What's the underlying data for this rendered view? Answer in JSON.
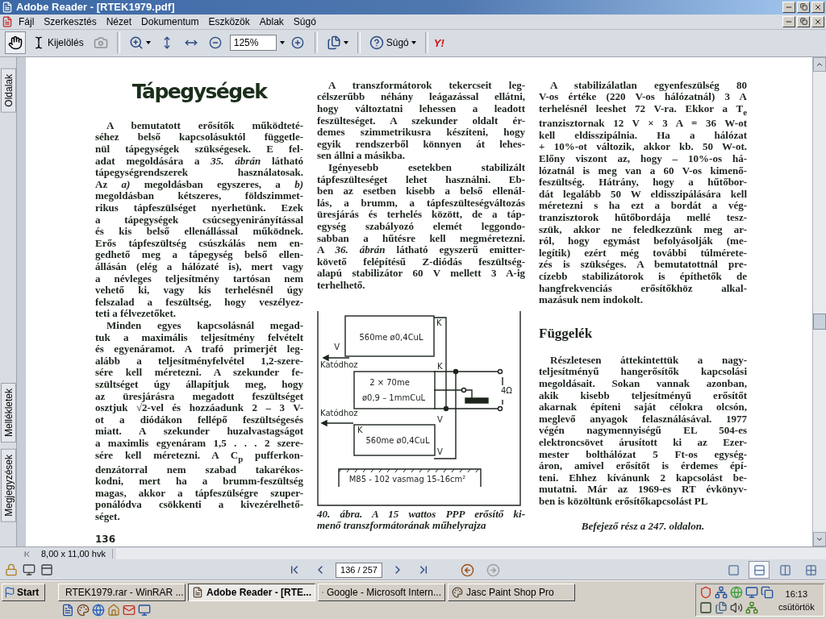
{
  "window": {
    "title": "Adobe Reader - [RTEK1979.pdf]"
  },
  "menu": [
    "Fájl",
    "Szerkesztés",
    "Nézet",
    "Dokumentum",
    "Eszközök",
    "Ablak",
    "Súgó"
  ],
  "toolbar": {
    "hand_selected": true,
    "select_label": "Kijelölés",
    "zoom": "125%",
    "help_label": "Súgó",
    "badge": "Y!"
  },
  "side_tabs": [
    "Oldalak",
    "Mellékletek",
    "Megjegyzések"
  ],
  "page": {
    "title": "Tápegységek",
    "left": [
      {
        "lines": [
          "A bemutatott erősítők működteté-",
          "séhez belső kapcsolásuktól függetle-",
          "nül tápegységek szükségesek. E fel-",
          "adat megoldására a *35. ábrán* látható",
          "tápegységrendszerek használatosak.",
          "Az *a)* megoldásban egyszeres, a *b)*",
          "megoldásban kétszeres, földszimmet-",
          "rikus tápfeszülséget nyerhetünk. Ezek",
          "a tápegységek csúcsegyenirányítással",
          "és kis belső ellenállással működnek.",
          "Erős tápfeszültség csúszkálás nem en-",
          "gedhető meg a tápegység belső ellen-",
          "állásán (elég a hálózaté is), mert vagy",
          "a névleges teljesítmény tartósan nem",
          "vehető ki, vagy kis terhelésnél úgy",
          "felszalad a feszültség, hogy veszélyez-",
          "teti a félvezetőket."
        ]
      },
      {
        "lines": [
          "Minden egyes kapcsolásnál megad-",
          "tuk a maximális teljesítmény felvételt",
          "és egyenáramot. A trafó primerjét leg-",
          "alább a teljesítményfelvétel 1,2-szere-",
          "sére kell méretezni. A szekunder fe-",
          "szültséget úgy állapítjuk meg, hogy",
          "az üresjárásra megadott feszültséget",
          "osztjuk √2-vel és hozzáadunk 2 – 3 V-",
          "ot a diódákon fellépő feszültségesés",
          "miatt. A szekunder huzalvastagságot",
          "a maximlis egyenáram 1,5 . . . 2 szere-",
          "sére kell méretezni. A C$_{p}$ pufferkon-",
          "denzátorral nem szabad takarékos-",
          "kodni, mert ha a brumm-feszültség",
          "magas, akkor a tápfeszülségre szuper-",
          "ponálódva csökkenti a kivezérelhető-",
          "séget."
        ]
      }
    ],
    "page_number": "136",
    "middle": [
      {
        "lines": [
          "A transzformátorok tekercseit leg-",
          "célszerűbb néhány leágazással ellátni,",
          "hogy változtatni lehessen a leadott",
          "feszülteséget. A szekunder oldalt ér-",
          "demes szimmetrikusra készíteni, hogy",
          "egyik rendszerből könnyen át lehes-",
          "sen állni a másikba."
        ]
      },
      {
        "lines": [
          "Igényesebb esetekben stabilizált",
          "tápfeszülteséget lehet használni. Eb-",
          "ben az esetben kisebb a belső ellenál-",
          "lás, a brumm, a tápfeszülteségváltozás",
          "üresjárás és terhelés között, de a táp-",
          "egység szabályozó elemét leggondo-",
          "sabban a hűtésre kell megméretezni.",
          "A *36. ábrán* látható egyszerű emitter-",
          "követő felépítésű Z-diódás feszültség-",
          "alapú stabilizátor 60 V mellett 3 A-ig",
          "terhelhető."
        ]
      }
    ],
    "figure": {
      "labels": [
        "560me ø0,4CuL",
        "K",
        "V",
        "Katódhoz",
        "K",
        "2 × 70me",
        "ø0,9 – 1mmCuL",
        "V",
        "4Ω",
        "Katódhoz",
        "K",
        "560me ø0,4CuL",
        "V",
        "M85 - 102 vasmag 15-16cm²"
      ]
    },
    "caption": {
      "lines": [
        "40. ábra. A 15 wattos PPP erősítő ki-",
        "menő transzformátorának műhelyrajza"
      ]
    },
    "right": [
      {
        "lines": [
          "A stabilizálatlan egyenfeszülség 80",
          "V-os értéke (220 V-os hálózatnál) 3 A",
          "terhelésnél leeshet 72 V-ra. Ekkor a T$_{e}$",
          "tranzisztornak 12 V × 3 A = 36 W-ot",
          "kell eldisszipálnia. Ha a hálózat",
          "+ 10%-ot változik, akkor kb. 50 W-ot.",
          "Előny viszont az, hogy – 10%-os há-",
          "lózatnál is meg van a 60 V-os kimenő-",
          "feszültség. Hátrány, hogy a hűtőbor-",
          "dát legalább 50 W eldisszipálására kell",
          "méretezni s ha ezt a bordát a vég-",
          "tranzisztorok hűtőbordája mellé tesz-",
          "szük, akkor ne feledkezzünk meg ar-",
          "ról, hogy egymást befolyásolják (me-",
          "legítik) ezért még további túlmérete-",
          "zés is szükséges. A bemutatottnál pre-",
          "cízebb stabilizátorok is építhetők de",
          "hangfrekvenciás erősítőkhöz alkal-",
          "mazásuk nem indokolt."
        ]
      }
    ],
    "section_heading": "Függelék",
    "section": [
      {
        "lines": [
          "Részletesen áttekintettük a nagy-",
          "teljesítményű hangerősítők kapcsolási",
          "megoldásait. Sokan vannak azonban,",
          "akik kisebb teljesítményű erősítőt",
          "akarnak építeni saját célokra olcsón,",
          "meglevő anyagok felasználásával. 1977",
          "végén nagymennyiségű EL 504-es",
          "elektroncsövet árusított ki az Ezer-",
          "mester bolthálózat 5 Ft-os egység-",
          "áron, amivel erősítőt is érdemes épí-",
          "teni. Ehhez kívánunk 2 kapcsolást be-",
          "mutatni. Már az 1969-es RT évkönyv-",
          "ben is közöltünk erősítőkapcsolást PL"
        ]
      }
    ],
    "continued": "Befejező rész a 247. oldalon."
  },
  "status": {
    "page_size": "8,00 x 11,00 hvk",
    "page_field": "136 / 257",
    "forward_disabled": true,
    "views": [
      {
        "kind": "single",
        "selected": false
      },
      {
        "kind": "continuous",
        "selected": true
      },
      {
        "kind": "facing",
        "selected": false
      },
      {
        "kind": "continuous_facing",
        "selected": false
      }
    ]
  },
  "taskbar": {
    "start": "Start",
    "tasks": [
      {
        "kind": "archive",
        "label": "RTEK1979.rar - WinRAR ...",
        "selected": false
      },
      {
        "kind": "reader",
        "label": "Adobe Reader - [RTE...",
        "selected": true
      },
      {
        "kind": "browser",
        "label": "Google - Microsoft Intern...",
        "selected": false
      },
      {
        "kind": "paint",
        "label": "Jasc Paint Shop Pro",
        "selected": false
      }
    ],
    "clock": "16:13",
    "day": "csütörtök"
  }
}
